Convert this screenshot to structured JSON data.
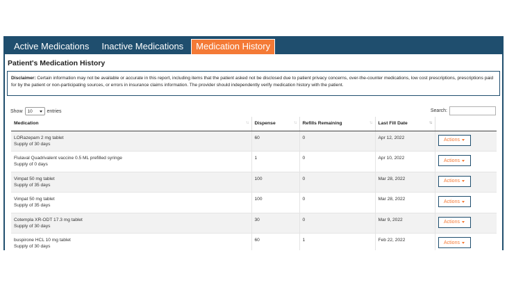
{
  "tabs": [
    {
      "label": "Active Medications",
      "active": false
    },
    {
      "label": "Inactive Medications",
      "active": false
    },
    {
      "label": "Medication History",
      "active": true
    }
  ],
  "section_title": "Patient's Medication History",
  "disclaimer": {
    "label": "Disclaimer:",
    "text": " Certain information may not be available or accurate in this report, including items that the patient asked not be disclosed due to patient privacy concerns, over-the-counter medications, low cost prescriptions, prescriptions paid for by the patient or non-participating sources, or errors in insurance claims information. The provider should independently verify medication history with the patient."
  },
  "controls": {
    "show_label": "Show",
    "entries_value": "10",
    "entries_label": "entries",
    "search_label": "Search:",
    "search_value": ""
  },
  "table": {
    "headers": [
      "Medication",
      "Dispense",
      "Refills Remaining",
      "Last Fill Date",
      ""
    ],
    "action_label": "Actions",
    "rows": [
      {
        "name": "LORazepam 2 mg tablet",
        "supply": "Supply of 30 days",
        "dispense": "60",
        "refills": "0",
        "date": "Apr 12, 2022"
      },
      {
        "name": "Flulaval Quadrivalent vaccine 0.5 ML prefilled syringe",
        "supply": "Supply of 0 days",
        "dispense": "1",
        "refills": "0",
        "date": "Apr 10, 2022"
      },
      {
        "name": "Vimpat 50 mg tablet",
        "supply": "Supply of 35 days",
        "dispense": "100",
        "refills": "0",
        "date": "Mar 28, 2022"
      },
      {
        "name": "Vimpat 50 mg tablet",
        "supply": "Supply of 35 days",
        "dispense": "100",
        "refills": "0",
        "date": "Mar 28, 2022"
      },
      {
        "name": "Cotempla XR-ODT 17.3 mg tablet",
        "supply": "Supply of 30 days",
        "dispense": "30",
        "refills": "0",
        "date": "Mar 9, 2022"
      },
      {
        "name": "buspirone HCL 10 mg tablet",
        "supply": "Supply of 30 days",
        "dispense": "60",
        "refills": "1",
        "date": "Feb 22, 2022"
      }
    ]
  },
  "colors": {
    "tabbar": "#1f4e6e",
    "accent": "#f47a36"
  }
}
